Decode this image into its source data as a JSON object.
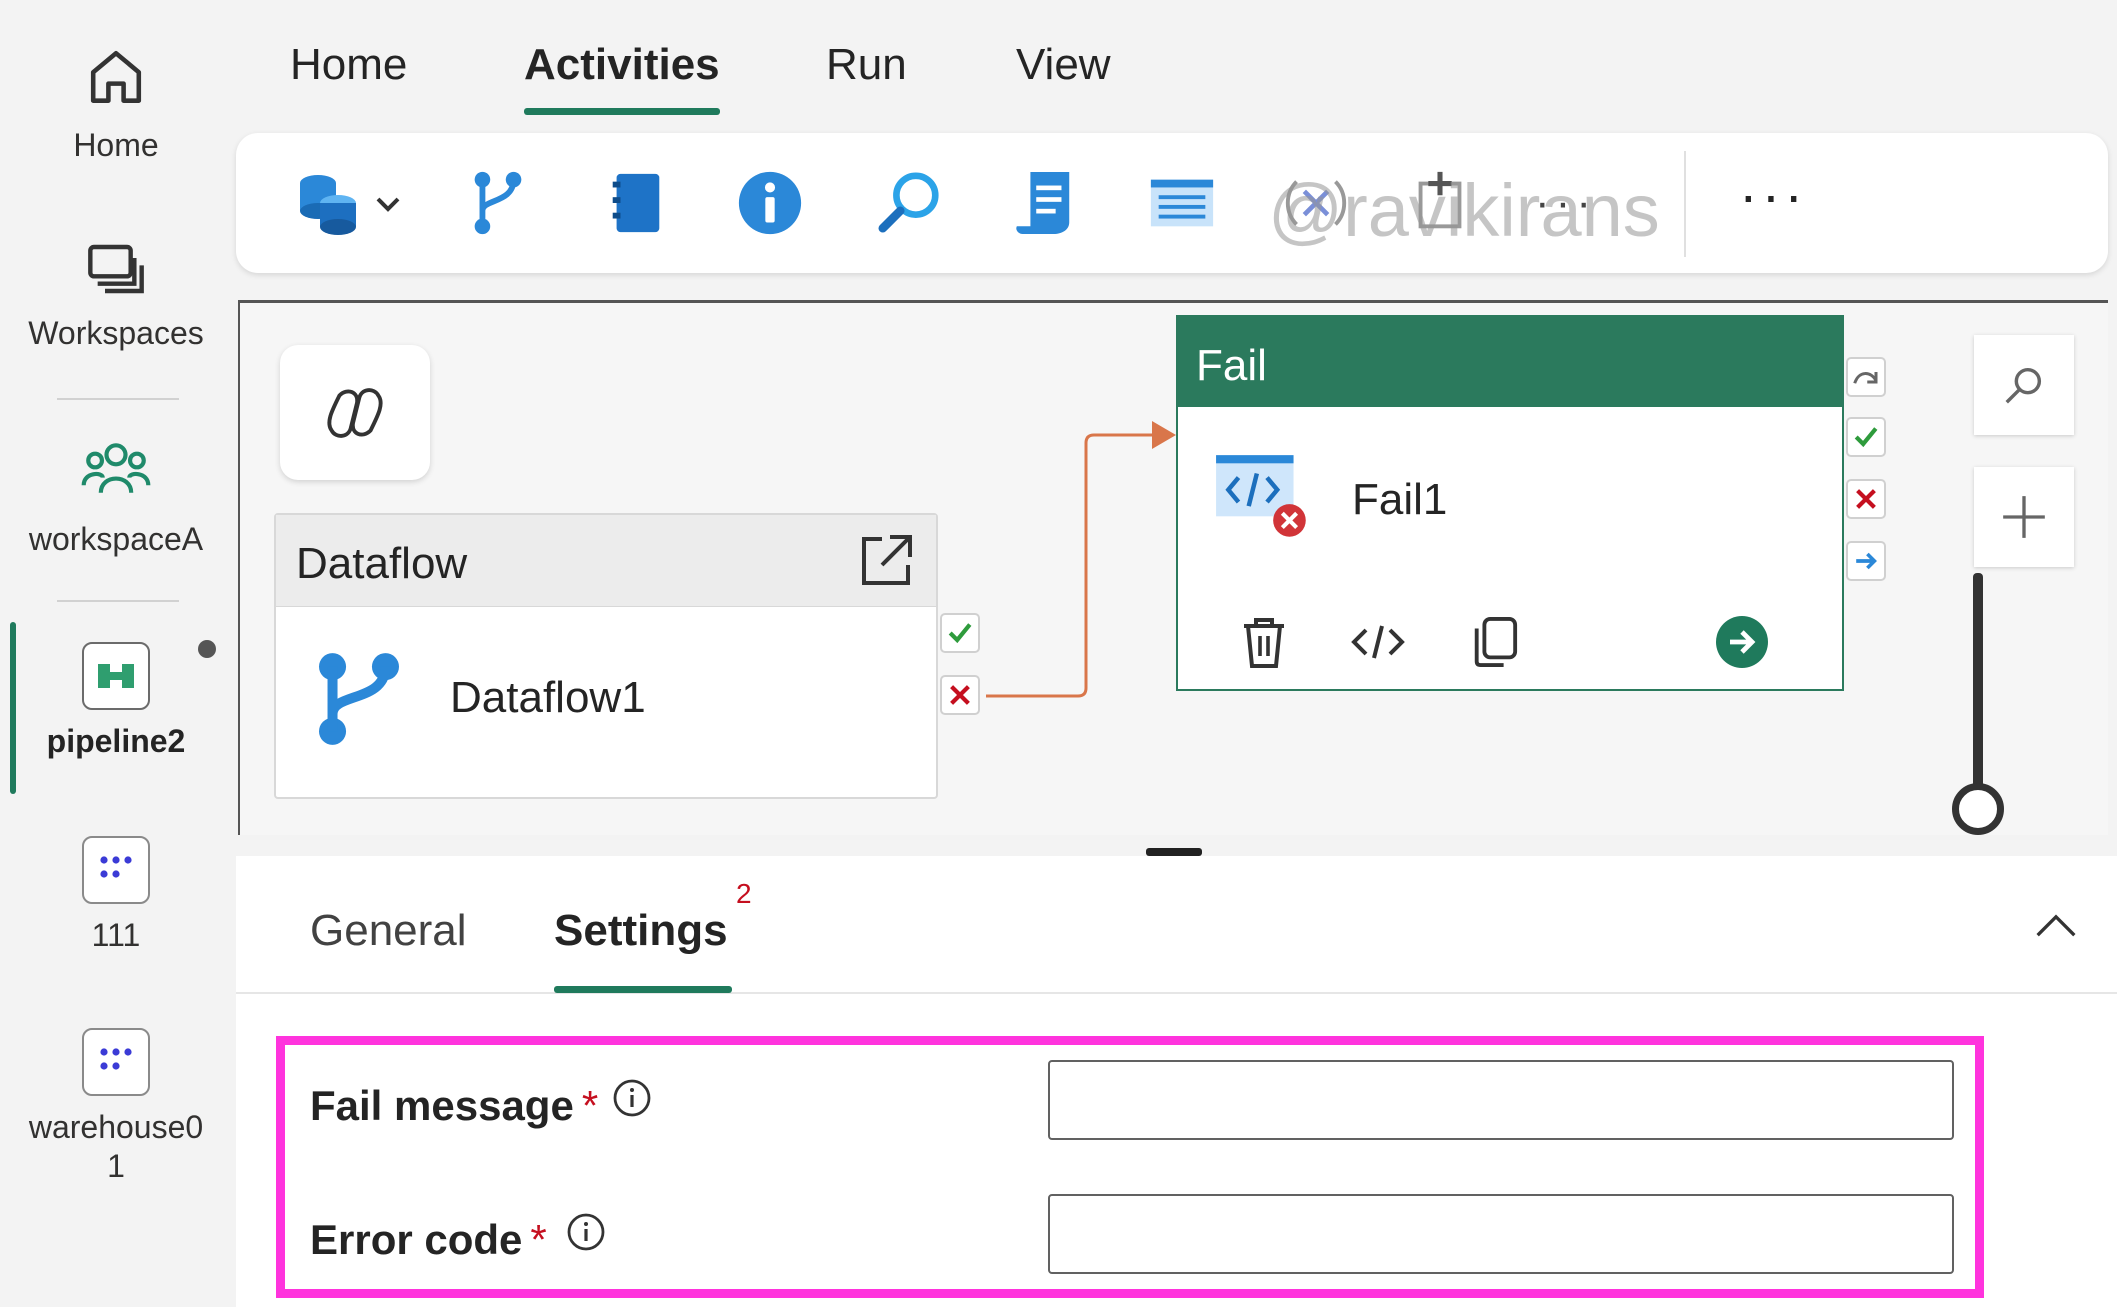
{
  "rail": {
    "items": [
      {
        "label": "Home",
        "icon": "home-icon"
      },
      {
        "label": "Workspaces",
        "icon": "workspaces-icon"
      },
      {
        "label": "workspaceA",
        "icon": "people-icon"
      },
      {
        "label": "pipeline2",
        "icon": "pipeline-icon",
        "active": true
      },
      {
        "label": "111",
        "icon": "warehouse-icon"
      },
      {
        "label": "warehouse0",
        "label_line2": "1",
        "icon": "warehouse-icon"
      }
    ]
  },
  "menu": {
    "tabs": [
      "Home",
      "Activities",
      "Run",
      "View"
    ],
    "active": "Activities"
  },
  "toolbar": {
    "more_label": "···",
    "watermark": "@ravikirans"
  },
  "canvas": {
    "dataflow_card": {
      "header": "Dataflow",
      "name": "Dataflow1"
    },
    "fail_card": {
      "header": "Fail",
      "name": "Fail1"
    }
  },
  "panel": {
    "tabs": [
      "General",
      "Settings"
    ],
    "active": "Settings",
    "settings_badge": "2",
    "fields": [
      {
        "label": "Fail message",
        "required": "*",
        "value": ""
      },
      {
        "label": "Error code",
        "required": "*",
        "value": ""
      }
    ]
  },
  "colors": {
    "accent": "#1f7a5c",
    "fail_header": "#2b7a5d",
    "required": "#c50f1f",
    "highlight": "#ff33dd",
    "connector": "#d9764a"
  }
}
